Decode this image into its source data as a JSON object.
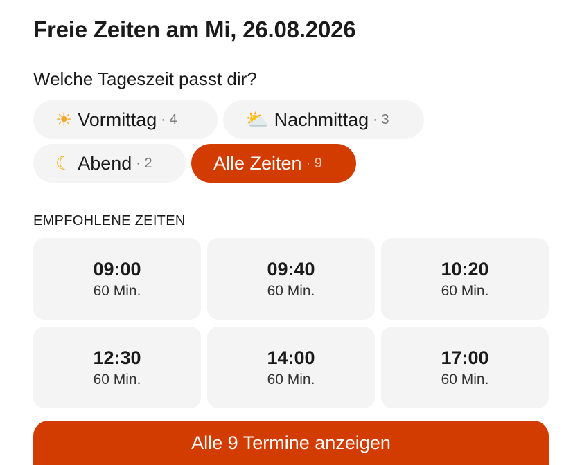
{
  "header": {
    "title": "Freie Zeiten am Mi, 26.08.2026",
    "question": "Welche Tageszeit passt dir?"
  },
  "filters": [
    {
      "icon": "sun-icon",
      "glyph": "☀",
      "label": "Vormittag",
      "count": "· 4",
      "active": false
    },
    {
      "icon": "sun-behind-cloud-icon",
      "glyph": "⛅",
      "label": "Nachmittag",
      "count": "· 3",
      "active": false
    },
    {
      "icon": "crescent-moon-icon",
      "glyph": "☾",
      "label": "Abend",
      "count": "· 2",
      "active": false
    },
    {
      "icon": null,
      "glyph": "",
      "label": "Alle Zeiten",
      "count": "· 9",
      "active": true
    }
  ],
  "recommended": {
    "heading": "EMPFOHLENE ZEITEN",
    "slots": [
      {
        "time": "09:00",
        "duration": "60 Min."
      },
      {
        "time": "09:40",
        "duration": "60 Min."
      },
      {
        "time": "10:20",
        "duration": "60 Min."
      },
      {
        "time": "12:30",
        "duration": "60 Min."
      },
      {
        "time": "14:00",
        "duration": "60 Min."
      },
      {
        "time": "17:00",
        "duration": "60 Min."
      }
    ]
  },
  "cta": {
    "label": "Alle 9 Termine anzeigen"
  },
  "colors": {
    "accent": "#d33c00",
    "chip_background": "#f4f4f5",
    "text": "#1a1a1a"
  }
}
